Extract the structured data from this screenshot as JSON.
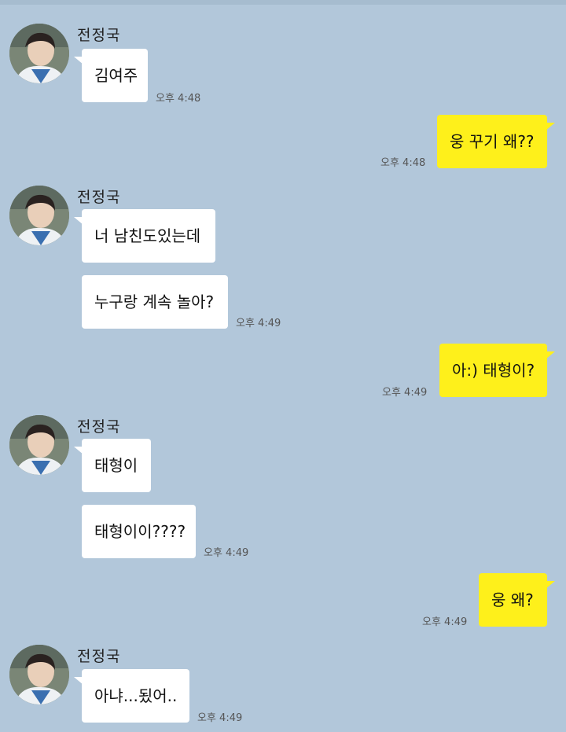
{
  "contact": {
    "name": "전정국"
  },
  "messages": [
    {
      "text": "김여주",
      "time": "오후 4:48"
    },
    {
      "text": "웅 꾸기 왜??",
      "time": "오후 4:48"
    },
    {
      "text": "너 남친도있는데"
    },
    {
      "text": "누구랑 계속 놀아?",
      "time": "오후 4:49"
    },
    {
      "text": "아:) 태형이?",
      "time": "오후 4:49"
    },
    {
      "text": "태형이"
    },
    {
      "text": "태형이이????",
      "time": "오후 4:49"
    },
    {
      "text": "웅 왜?",
      "time": "오후 4:49"
    },
    {
      "text": "아냐...됬어..",
      "time": "오후 4:49"
    }
  ],
  "colors": {
    "background": "#b2c7da",
    "outgoing": "#fef01b",
    "incoming": "#ffffff"
  },
  "icons": {
    "avatar": "profile-photo"
  }
}
